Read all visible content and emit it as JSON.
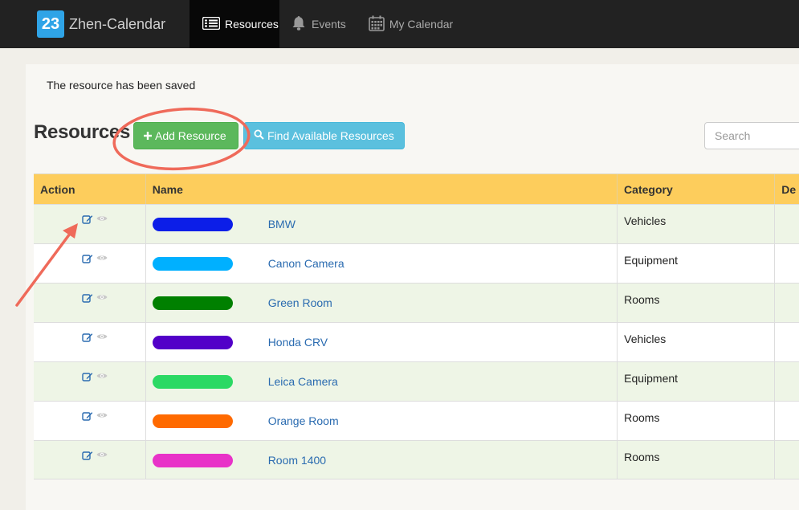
{
  "navbar": {
    "brand_badge": "23",
    "brand_name": "Zhen-Calendar",
    "items": [
      {
        "label": "Resources",
        "icon": "list-icon",
        "active": true
      },
      {
        "label": "Events",
        "icon": "bell-icon",
        "active": false
      },
      {
        "label": "My Calendar",
        "icon": "calendar-icon",
        "active": false
      }
    ]
  },
  "alert": {
    "message": "The resource has been saved"
  },
  "page": {
    "title": "Resources",
    "add_button": "Add Resource",
    "find_button": "Find Available Resources",
    "search_placeholder": "Search"
  },
  "table": {
    "headers": [
      "Action",
      "Name",
      "Category",
      "De"
    ],
    "rows": [
      {
        "color": "#0c1ee8",
        "name": "BMW",
        "category": "Vehicles"
      },
      {
        "color": "#00b0ff",
        "name": "Canon Camera",
        "category": "Equipment"
      },
      {
        "color": "#008000",
        "name": "Green Room",
        "category": "Rooms"
      },
      {
        "color": "#5200c8",
        "name": "Honda CRV",
        "category": "Vehicles"
      },
      {
        "color": "#2bd964",
        "name": "Leica Camera",
        "category": "Equipment"
      },
      {
        "color": "#ff6a00",
        "name": "Orange Room",
        "category": "Rooms"
      },
      {
        "color": "#e832c8",
        "name": "Room 1400",
        "category": "Rooms"
      }
    ]
  },
  "colors": {
    "navbar_bg": "#222222",
    "header_bg": "#fdcd5c",
    "add_button": "#5cb85c",
    "find_button": "#5bc0de",
    "link": "#2a6bb0",
    "annotation": "#ef6a5a"
  }
}
